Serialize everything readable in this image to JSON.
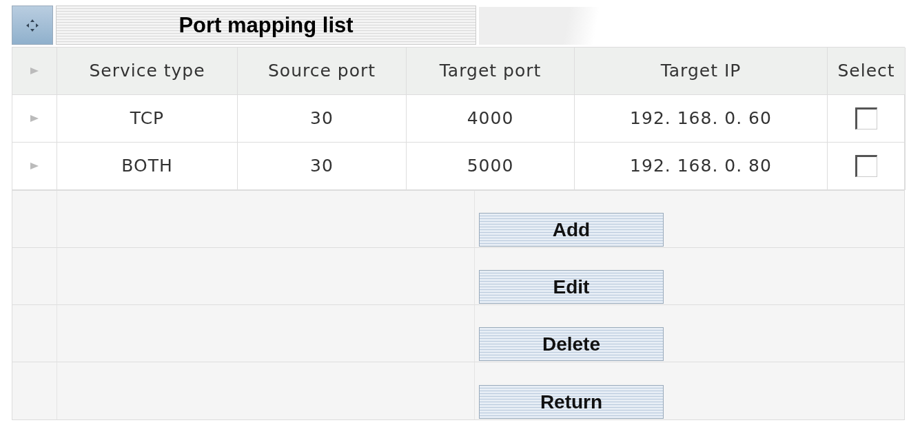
{
  "title": "Port mapping list",
  "table": {
    "columns": [
      "Service type",
      "Source port",
      "Target port",
      "Target IP",
      "Select"
    ],
    "rows": [
      {
        "service_type": "TCP",
        "source_port": "30",
        "target_port": "4000",
        "target_ip": "192. 168. 0. 60",
        "checked": false
      },
      {
        "service_type": "BOTH",
        "source_port": "30",
        "target_port": "5000",
        "target_ip": "192. 168. 0. 80",
        "checked": false
      }
    ]
  },
  "buttons": [
    "Add",
    "Edit",
    "Delete",
    "Return"
  ]
}
